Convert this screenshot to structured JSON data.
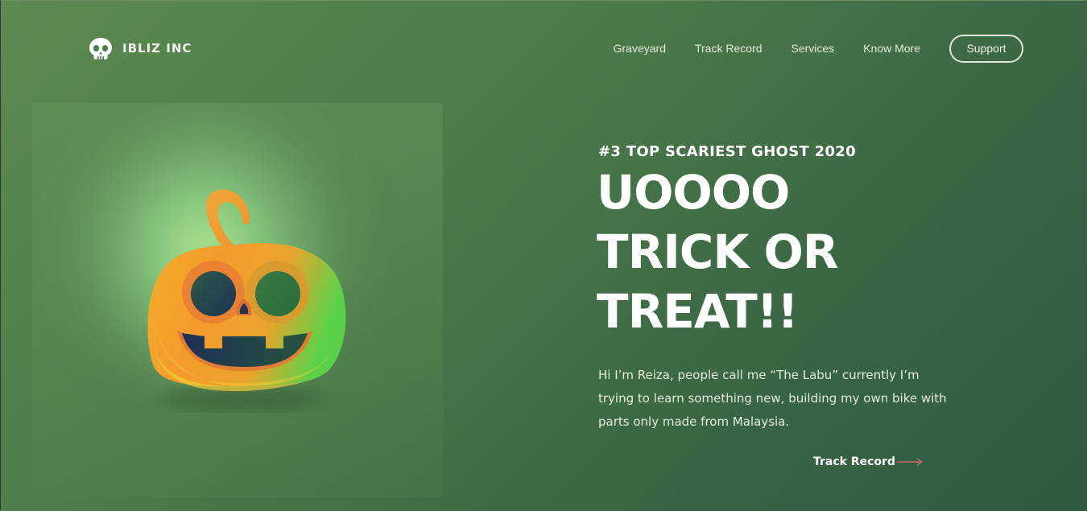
{
  "brand": {
    "name": "IBLIZ INC",
    "logo_icon": "skull-icon"
  },
  "nav": {
    "items": [
      {
        "label": "Graveyard"
      },
      {
        "label": "Track Record"
      },
      {
        "label": "Services"
      },
      {
        "label": "Know More"
      }
    ],
    "support_label": "Support"
  },
  "hero": {
    "eyebrow": "#3 TOP SCARIEST GHOST 2020",
    "headline_lines": [
      "UOOOO",
      "TRICK OR",
      "TREAT!!"
    ],
    "intro": "Hi I’m Reiza, people call me “The Labu” currently I’m trying to learn something new, building my own bike with parts only made from Malaysia.",
    "cta_label": "Track Record",
    "cta_icon": "arrow-right-icon",
    "illustration_icon": "jack-o-lantern-icon"
  },
  "colors": {
    "background": "#4c7a4a",
    "background_dark": "#2f5940",
    "text": "#ffffff",
    "accent_arrow": "#c96a6a"
  }
}
